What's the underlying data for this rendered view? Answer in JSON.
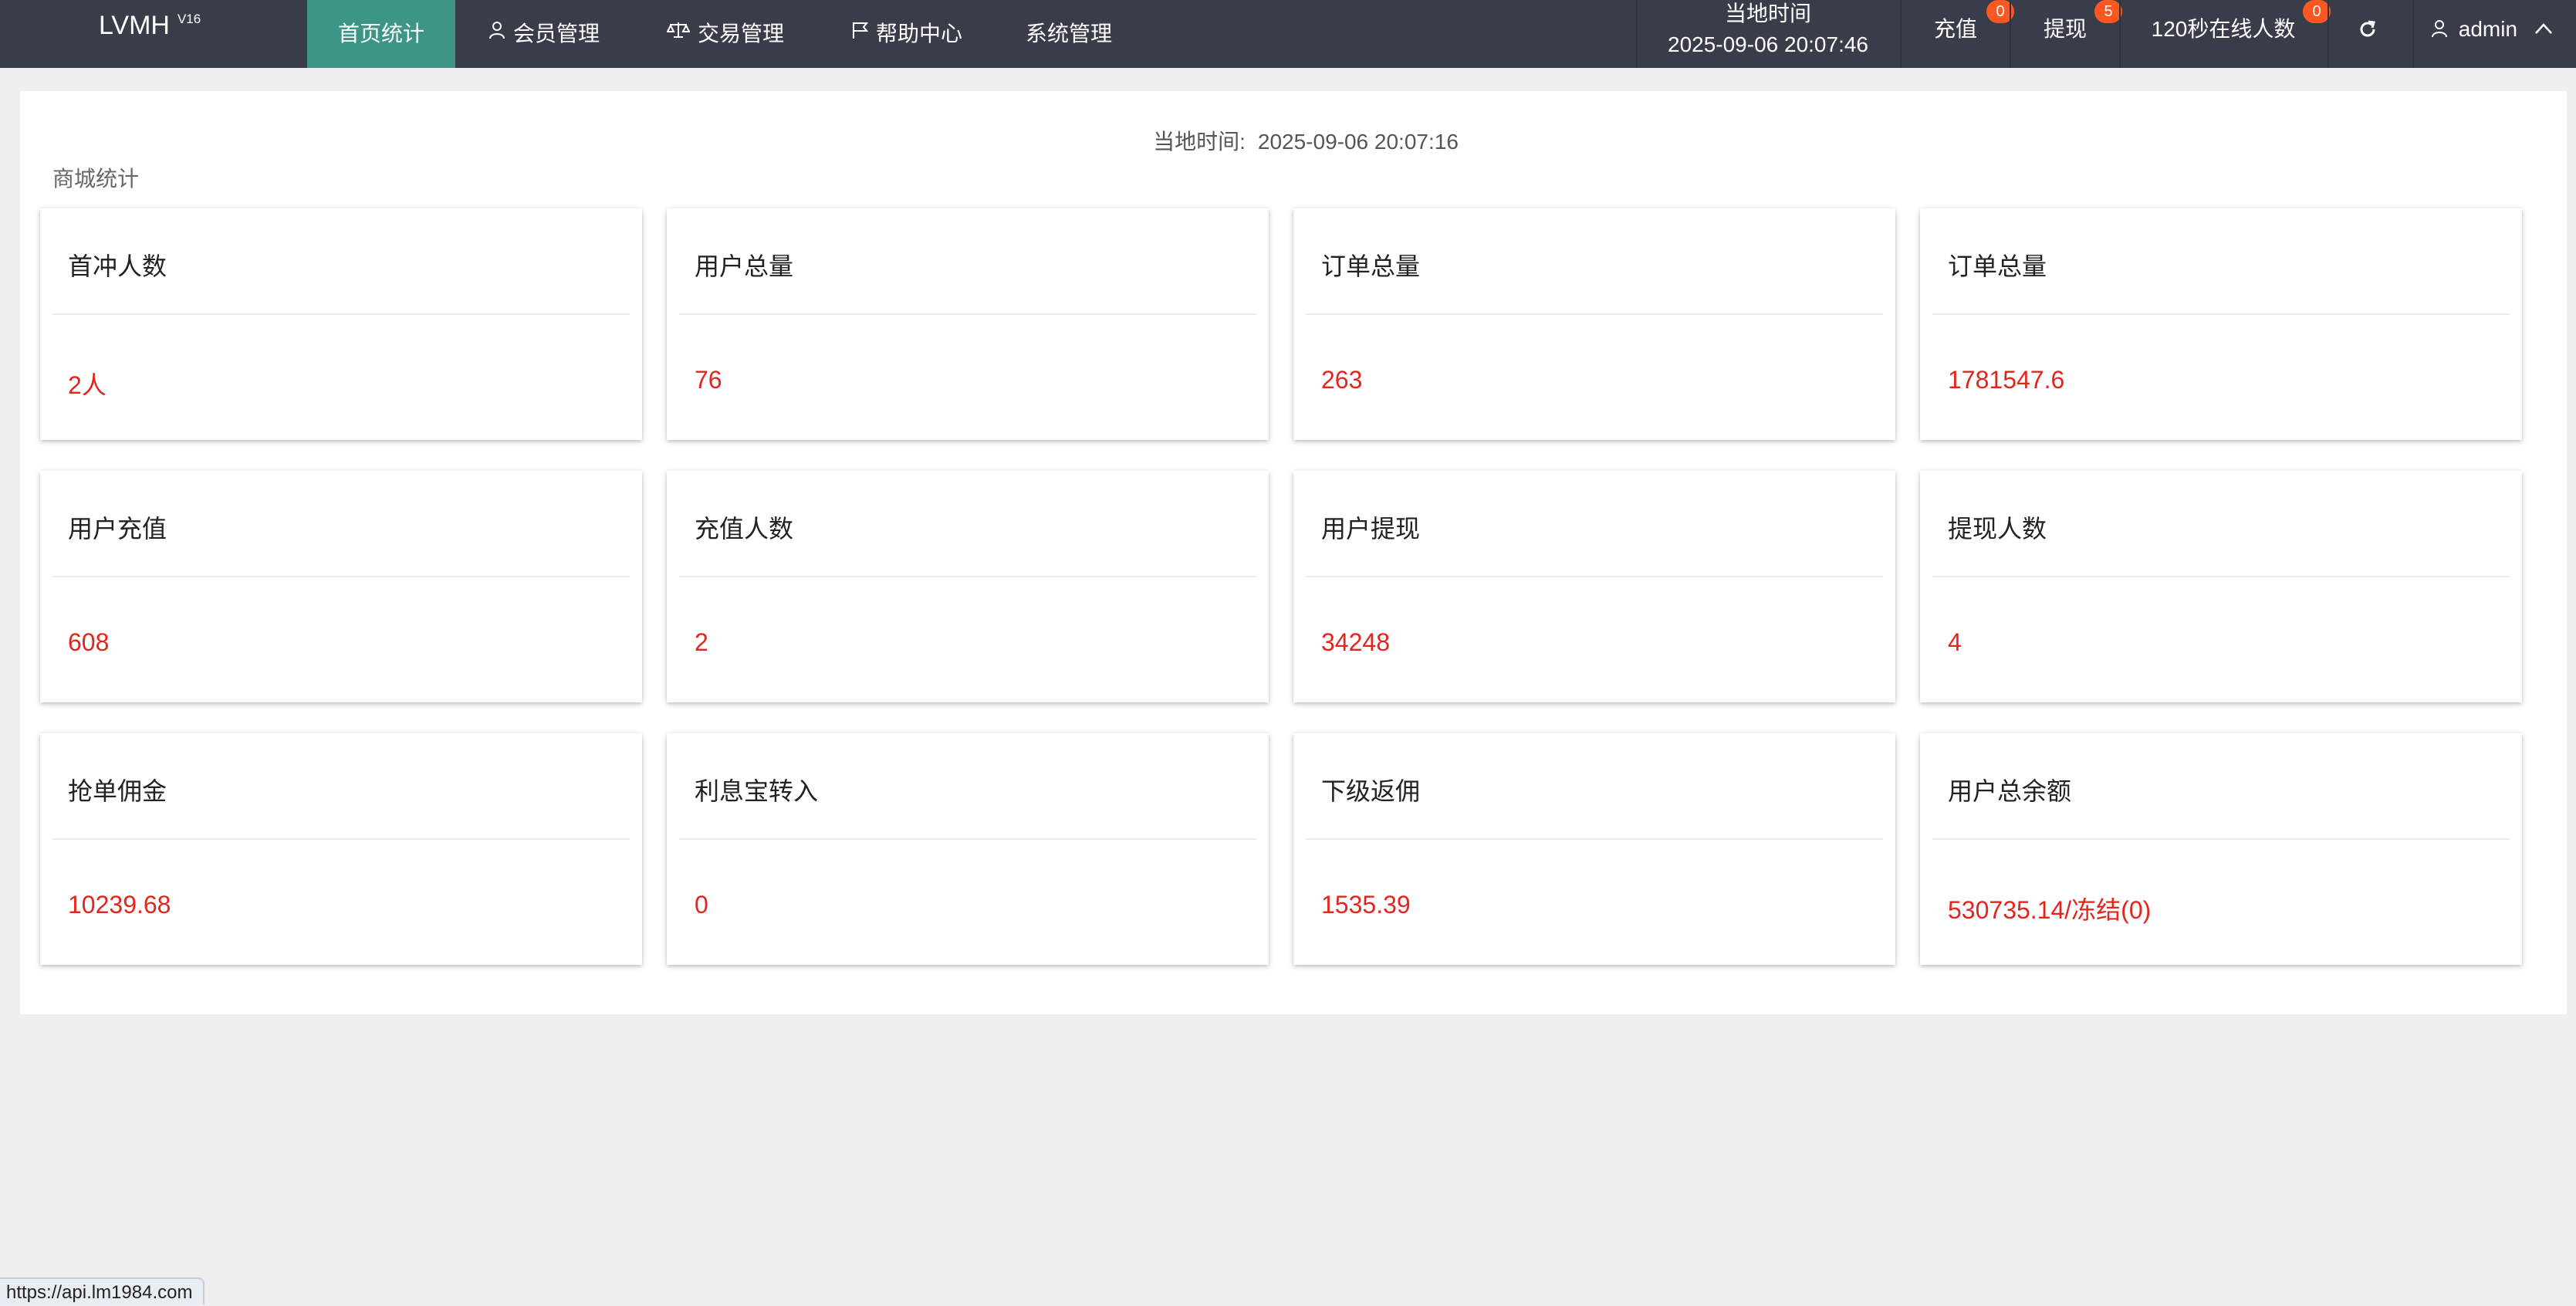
{
  "app": {
    "brand": "LVMH",
    "version": "V16"
  },
  "nav": {
    "home": "首页统计",
    "member": "会员管理",
    "trade": "交易管理",
    "help": "帮助中心",
    "system": "系统管理"
  },
  "header_right": {
    "time_label": "当地时间",
    "time_value": "2025-09-06 20:07:46",
    "recharge_label": "充值",
    "recharge_badge": "0",
    "withdraw_label": "提现",
    "withdraw_badge": "5",
    "online_label": "120秒在线人数",
    "online_badge": "0",
    "refresh_icon": "refresh-icon",
    "user": "admin"
  },
  "main": {
    "local_time_label": "当地时间:",
    "local_time_value": "2025-09-06 20:07:16",
    "section_title": "商城统计"
  },
  "cards": [
    {
      "title": "首冲人数",
      "value": "2人"
    },
    {
      "title": "用户总量",
      "value": "76"
    },
    {
      "title": "订单总量",
      "value": "263"
    },
    {
      "title": "订单总量",
      "value": "1781547.6"
    },
    {
      "title": "用户充值",
      "value": "608"
    },
    {
      "title": "充值人数",
      "value": "2"
    },
    {
      "title": "用户提现",
      "value": "34248"
    },
    {
      "title": "提现人数",
      "value": "4"
    },
    {
      "title": "抢单佣金",
      "value": "10239.68"
    },
    {
      "title": "利息宝转入",
      "value": "0"
    },
    {
      "title": "下级返佣",
      "value": "1535.39"
    },
    {
      "title": "用户总余额",
      "value": "530735.14/冻结(0)"
    }
  ],
  "status_bar": {
    "url": "https://api.lm1984.com"
  },
  "colors": {
    "topbar": "#393d49",
    "active_tab": "#3d9588",
    "value_red": "#e2261e",
    "badge": "#ff5722"
  }
}
